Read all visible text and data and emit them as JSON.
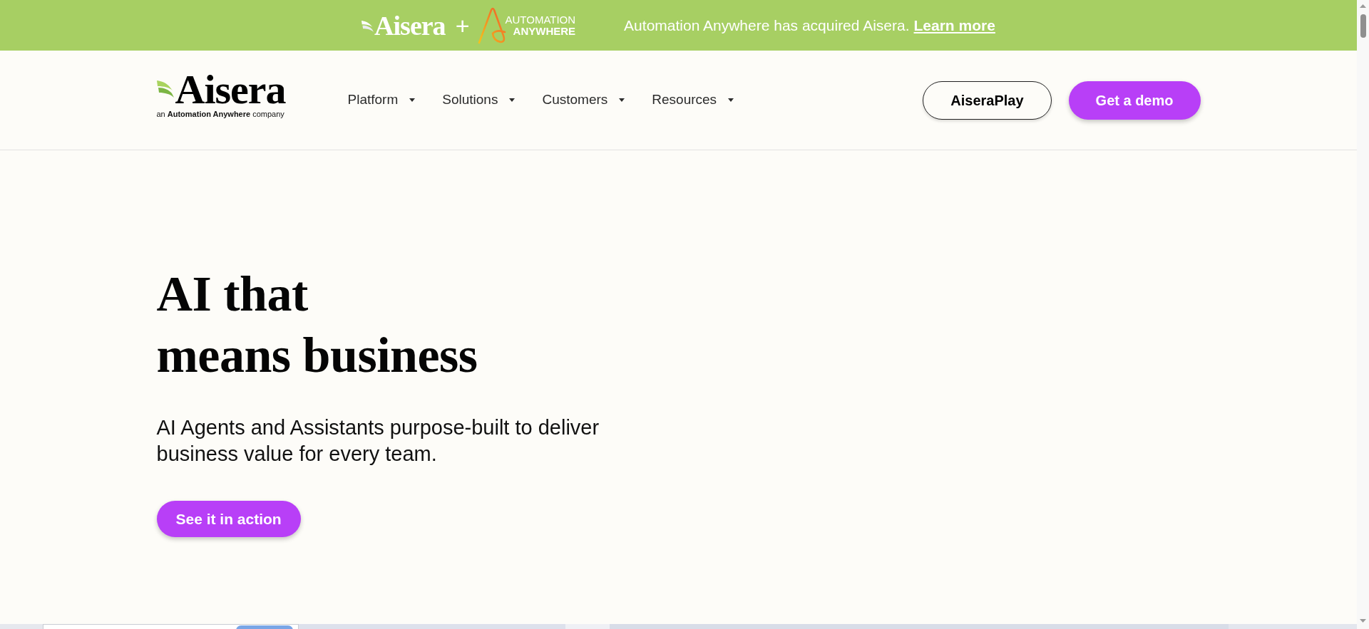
{
  "announcement_bar": {
    "logo": {
      "wordmark": "Aisera"
    },
    "plus": "+",
    "partner_logo": {
      "line_1": "AUTOMATION",
      "line_2": "ANYWHERE"
    },
    "message": "Automation Anywhere has acquired Aisera.",
    "link": "Learn more"
  },
  "header": {
    "logo": {
      "wordmark": "Aisera",
      "tagline": "an **Automation Anywhere** company"
    },
    "nav": [
      {
        "label": "Platform",
        "has_menu": true
      },
      {
        "label": "Solutions",
        "has_menu": true
      },
      {
        "label": "Customers",
        "has_menu": true
      },
      {
        "label": "Resources",
        "has_menu": true
      }
    ],
    "buttons": [
      {
        "label": "AiseraPlay",
        "kind": "outline"
      },
      {
        "label": "Get a demo",
        "kind": "primary"
      }
    ]
  },
  "hero": {
    "title_lines": [
      "AI that",
      "means business"
    ],
    "subtitle": "AI Agents and Assistants purpose-built to deliver business value for every team.",
    "button": {
      "label": "See it in action",
      "kind": "primary"
    }
  }
}
